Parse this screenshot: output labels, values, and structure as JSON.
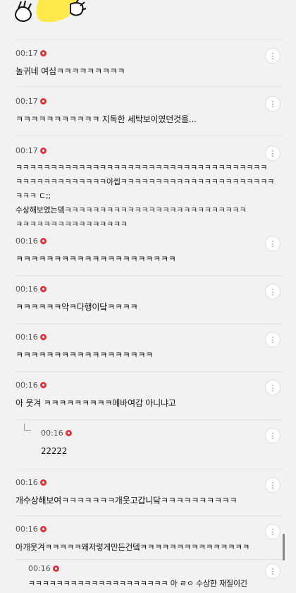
{
  "comments": [
    {
      "time": "00:17",
      "text": "놀귀네 여심ㅋㅋㅋㅋㅋㅋㅋㅋㅋ"
    },
    {
      "time": "00:17",
      "text": "ㅋㅋㅋㅋㅋㅋㅋㅋㅋㅋㅋ 지독한 세탁보이였던것을..."
    },
    {
      "time": "00:17",
      "text": "ㅋㅋㅋㅋㅋㅋㅋㅋㅋㅋㅋㅋㅋㅋㅋㅋㅋㅋㅋㅋㅋㅋㅋㅋㅋㅋㅋㅋㅋㅋㅋㅋㅋㅋㅋㅋ\nㅋㅋㅋㅋㅋㅋㅋㅋㅋㅋㅋㅋㅋ아씹ㅋㅋㅋㅋㅋㅋㅋㅋㅋㅋㅋㅋㅋㅋㅋㅋㅋㅋㅋㅋㅋㅋ\nㅋㅋㅋ ㄷ;;\n수상해보였는뎈ㅋㅋㅋㅋㅋㅋㅋㅋㅋㅋㅋㅋㅋㅋㅋㅋㅋㅋㅋㅋㅋㅋㅋㅋㅋㅋ\nㅋㅋㅋㅋㅋㅋㅋㅋㅋㅋㅋㅋㅋㅋㅋㅋ"
    },
    {
      "time": "00:16",
      "text": "ㅋㅋㅋㅋㅋㅋㅋㅋㅋㅋㅋㅋㅋㅋㅋㅋㅋㅋㅋㅋㅋ"
    },
    {
      "time": "00:16",
      "text": "ㅋㅋㅋㅋㅋㅋ악ㅋ다행이닼ㅋㅋㅋㅋ"
    },
    {
      "time": "00:16",
      "text": "ㅋㅋㅋㅋㅋㅋㅋㅋㅋㅋㅋㅋㅋㅋㅋㅋㅋㅋ"
    },
    {
      "time": "00:16",
      "text": "아 웃겨 ㅋㅋㅋㅋㅋㅋㅋㅋㅋ메바여감 아니냐고"
    },
    {
      "time": "00:16",
      "text": "22222"
    },
    {
      "time": "00:16",
      "text": "개수상해보여ㅋㅋㅋㅋㅋㅋㅋ개웃고갑니닼ㅋㅋㅋㅋㅋㅋㅋㅋㅋㅋ"
    },
    {
      "time": "00:16",
      "text": "아개웃겨ㅋㅋㅋㅋㅋ왜저렇게만든건뎈ㅋㅋㅋㅋㅋㅋㅋㅋㅋㅋㅋㅋㅋㅋㅋ"
    },
    {
      "time": "00:16",
      "text": "ㅋㅋㅋㅋㅋㅋㅋㅋㅋㅋㅋㅋㅋㅋㅋㅋㅋㅋㅋㅋ 아 ㄹㅇ 수상한 재질이긴"
    }
  ],
  "more_icon": "⋮",
  "colors": {
    "accent": "#e0343a",
    "background": "#f2f2f2",
    "artwork": "#ffe94a"
  }
}
